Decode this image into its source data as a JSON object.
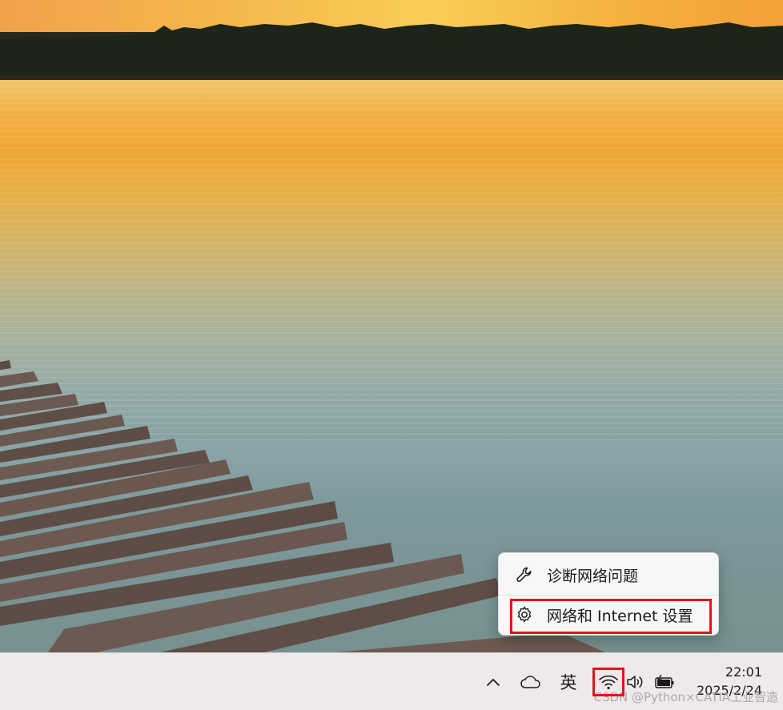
{
  "context_menu": {
    "items": [
      {
        "label": "诊断网络问题",
        "icon": "wrench-icon"
      },
      {
        "label": "网络和 Internet 设置",
        "icon": "gear-icon"
      }
    ]
  },
  "taskbar": {
    "tray": {
      "chevron_icon": "chevron-up-icon",
      "onedrive_icon": "cloud-icon",
      "ime_label": "英",
      "wifi_icon": "wifi-icon",
      "volume_icon": "speaker-icon",
      "battery_icon": "battery-charging-icon"
    },
    "clock": {
      "time": "22:01",
      "date": "2025/2/24"
    }
  },
  "watermark": "CSDN @Python×CATIA工业智造",
  "colors": {
    "highlight": "#e0141e",
    "taskbar_bg": "#efeaea",
    "menu_bg": "#f7f7f7"
  }
}
